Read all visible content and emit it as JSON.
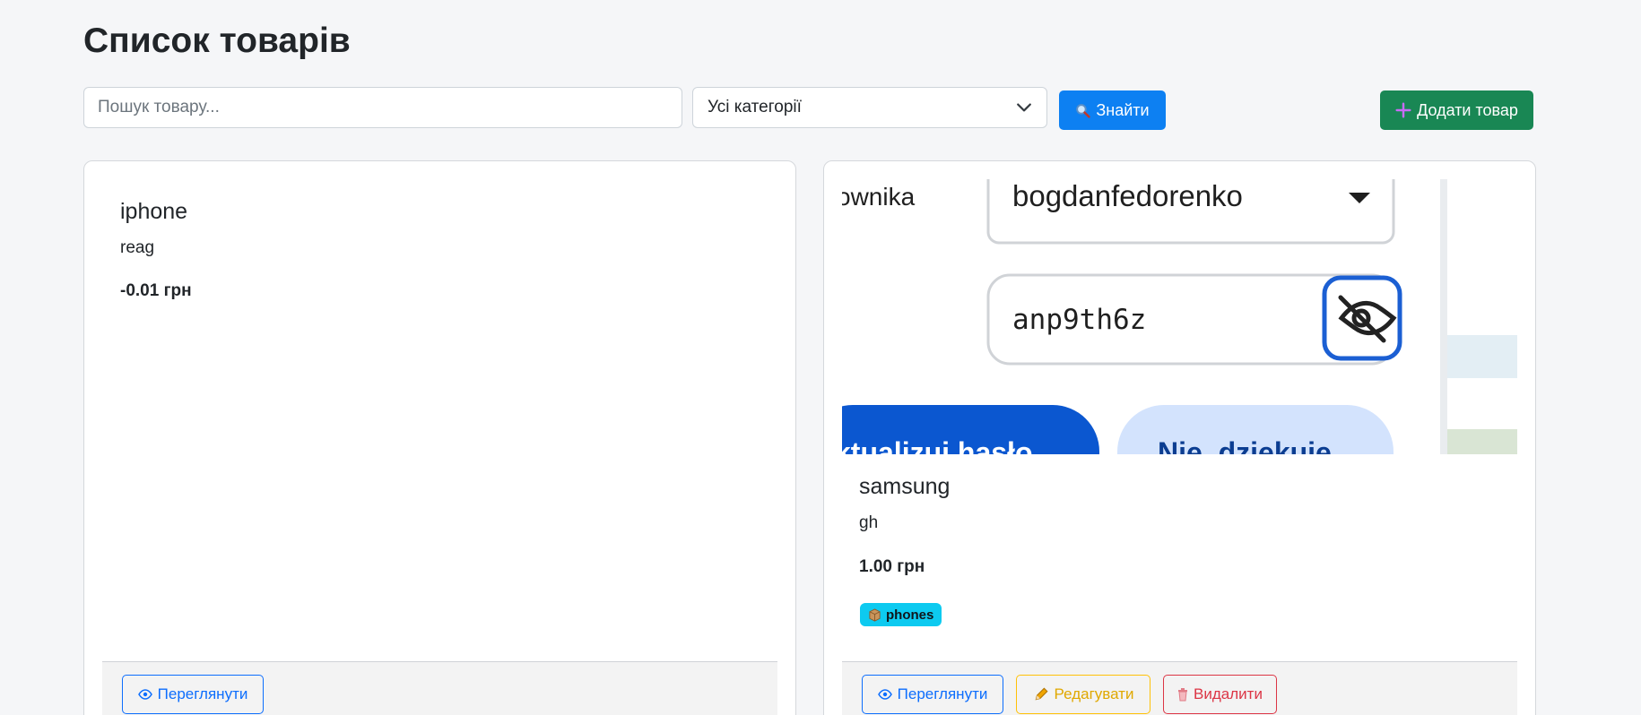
{
  "page": {
    "title": "Список товарів"
  },
  "toolbar": {
    "search_placeholder": "Пошук товару...",
    "category_selected": "Усі категорії",
    "find_label": "Знайти",
    "add_label": "Додати товар"
  },
  "products": [
    {
      "name": "iphone",
      "description": "reag",
      "price": "-0.01 грн",
      "view_label": "Переглянути"
    },
    {
      "name": "samsung",
      "description": "gh",
      "price": "1.00 грн",
      "category_badge": "phones",
      "image": {
        "left_label": "ownika",
        "username": "bogdanfedorenko",
        "password": "anp9th6z",
        "primary_button": "ktualizuj hasło",
        "secondary_button": "Nie, dziękuję"
      },
      "view_label": "Переглянути",
      "edit_label": "Редагувати",
      "delete_label": "Видалити"
    }
  ],
  "colors": {
    "primary": "#0d80f2",
    "success": "#198754",
    "warning": "#ffc107",
    "danger": "#dc3545",
    "info": "#0dcaf0"
  },
  "icons": {
    "find": "magnifier-icon",
    "add": "plus-icon",
    "view": "eye-icon",
    "edit": "pencil-icon",
    "delete": "trash-icon",
    "badge": "box-icon",
    "select": "chevron-down-icon",
    "password_toggle": "eye-slash-icon",
    "dropdown": "caret-down-icon"
  }
}
